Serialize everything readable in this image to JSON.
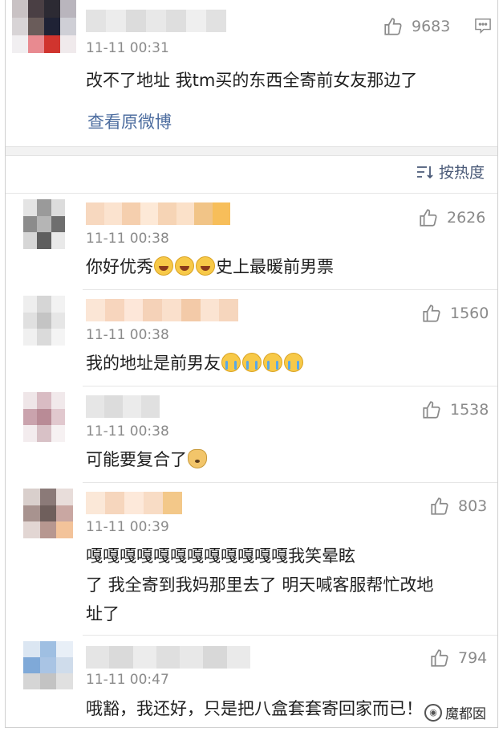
{
  "top_comment": {
    "time": "11-11 00:31",
    "likes": "9683",
    "text": "改不了地址 我tm买的东西全寄前女友那边了",
    "view_original": "查看原微博"
  },
  "sort": {
    "label": "按热度",
    "icon": "sort-lines-icon"
  },
  "comments": [
    {
      "time": "11-11 00:38",
      "likes": "2626",
      "text": "你好优秀",
      "suffix": "史上最暖前男票",
      "emoji": [
        "laugh",
        "laugh",
        "laugh"
      ]
    },
    {
      "time": "11-11 00:38",
      "likes": "1560",
      "text": "我的地址是前男友",
      "suffix": "",
      "emoji": [
        "cry",
        "cry",
        "cry",
        "cry"
      ]
    },
    {
      "time": "11-11 00:38",
      "likes": "1538",
      "text": "可能要复合了",
      "suffix": "",
      "emoji": [
        "dog"
      ]
    },
    {
      "time": "11-11 00:39",
      "likes": "803",
      "line1": "嘎嘎嘎嘎嘎嘎嘎嘎嘎嘎嘎嘎我笑晕眩",
      "line2": "了 我全寄到我妈那里去了 明天喊客服帮忙改地",
      "line3": "址了"
    },
    {
      "time": "11-11 00:47",
      "likes": "794",
      "text": "哦豁，我还好，只是把八盒套套寄回家而已！"
    }
  ],
  "watermark": "魔都囡"
}
